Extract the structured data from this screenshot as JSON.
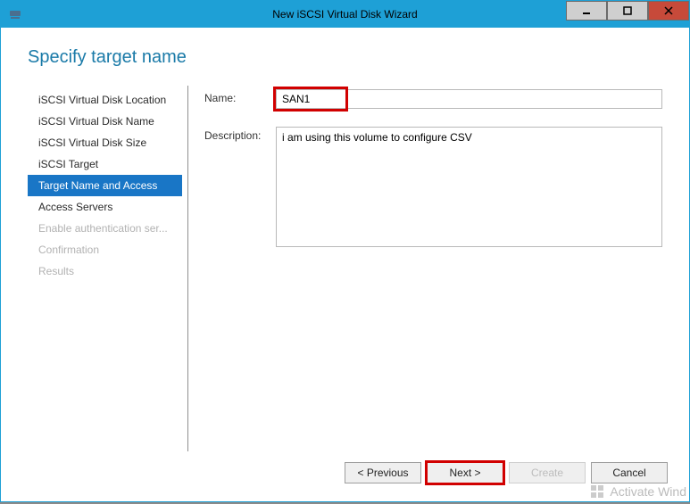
{
  "window": {
    "title": "New iSCSI Virtual Disk Wizard"
  },
  "page": {
    "title": "Specify target name"
  },
  "sidebar": {
    "items": [
      {
        "label": "iSCSI Virtual Disk Location",
        "state": "normal"
      },
      {
        "label": "iSCSI Virtual Disk Name",
        "state": "normal"
      },
      {
        "label": "iSCSI Virtual Disk Size",
        "state": "normal"
      },
      {
        "label": "iSCSI Target",
        "state": "normal"
      },
      {
        "label": "Target Name and Access",
        "state": "selected"
      },
      {
        "label": "Access Servers",
        "state": "normal"
      },
      {
        "label": "Enable authentication ser...",
        "state": "disabled"
      },
      {
        "label": "Confirmation",
        "state": "disabled"
      },
      {
        "label": "Results",
        "state": "disabled"
      }
    ]
  },
  "form": {
    "name_label": "Name:",
    "name_value": "SAN1",
    "desc_label": "Description:",
    "desc_value": "i am using this volume to configure CSV"
  },
  "footer": {
    "previous": "< Previous",
    "next": "Next >",
    "create": "Create",
    "cancel": "Cancel"
  },
  "watermark": "Activate Wind"
}
